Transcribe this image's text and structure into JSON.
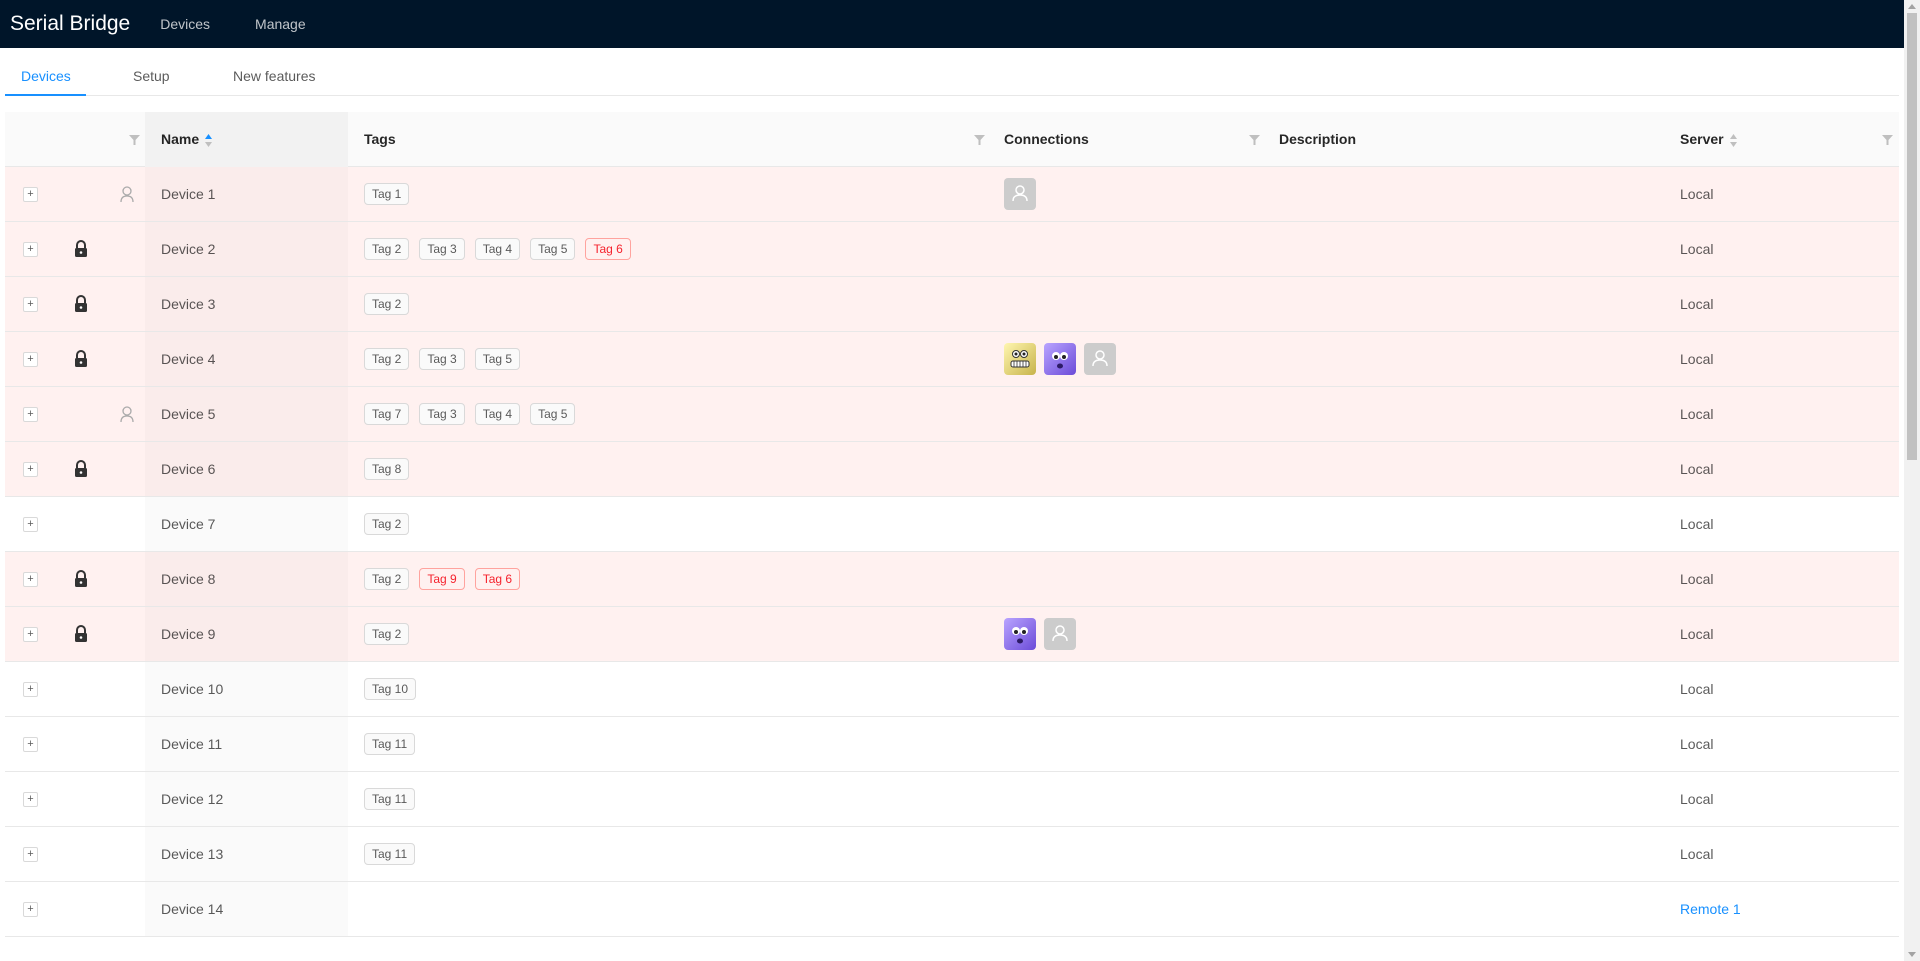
{
  "header": {
    "brand": "Serial Bridge",
    "nav": [
      {
        "label": "Devices"
      },
      {
        "label": "Manage"
      }
    ]
  },
  "tabs": [
    {
      "label": "Devices",
      "active": true
    },
    {
      "label": "Setup"
    },
    {
      "label": "New features"
    }
  ],
  "table": {
    "columns": {
      "name": "Name",
      "tags": "Tags",
      "connections": "Connections",
      "description": "Description",
      "server": "Server"
    },
    "rows": [
      {
        "name": "Device 1",
        "status": "user-icon",
        "alert": true,
        "tags": [
          {
            "label": "Tag 1"
          }
        ],
        "connections": [
          "placeholder"
        ],
        "server": "Local"
      },
      {
        "name": "Device 2",
        "status": "lock-icon",
        "alert": true,
        "tags": [
          {
            "label": "Tag 2"
          },
          {
            "label": "Tag 3"
          },
          {
            "label": "Tag 4"
          },
          {
            "label": "Tag 5"
          },
          {
            "label": "Tag 6",
            "red": true
          }
        ],
        "connections": [],
        "server": "Local"
      },
      {
        "name": "Device 3",
        "status": "lock-icon",
        "alert": true,
        "tags": [
          {
            "label": "Tag 2"
          }
        ],
        "connections": [],
        "server": "Local"
      },
      {
        "name": "Device 4",
        "status": "lock-icon",
        "alert": true,
        "tags": [
          {
            "label": "Tag 2"
          },
          {
            "label": "Tag 3"
          },
          {
            "label": "Tag 5"
          }
        ],
        "connections": [
          "yellow",
          "purple",
          "placeholder"
        ],
        "server": "Local"
      },
      {
        "name": "Device 5",
        "status": "user-icon",
        "alert": true,
        "tags": [
          {
            "label": "Tag 7"
          },
          {
            "label": "Tag 3"
          },
          {
            "label": "Tag 4"
          },
          {
            "label": "Tag 5"
          }
        ],
        "connections": [],
        "server": "Local"
      },
      {
        "name": "Device 6",
        "status": "lock-icon",
        "alert": true,
        "tags": [
          {
            "label": "Tag 8"
          }
        ],
        "connections": [],
        "server": "Local"
      },
      {
        "name": "Device 7",
        "status": "",
        "alert": false,
        "tags": [
          {
            "label": "Tag 2"
          }
        ],
        "connections": [],
        "server": "Local"
      },
      {
        "name": "Device 8",
        "status": "lock-icon",
        "alert": true,
        "tags": [
          {
            "label": "Tag 2"
          },
          {
            "label": "Tag 9",
            "red": true
          },
          {
            "label": "Tag 6",
            "red": true
          }
        ],
        "connections": [],
        "server": "Local"
      },
      {
        "name": "Device 9",
        "status": "lock-icon",
        "alert": true,
        "tags": [
          {
            "label": "Tag 2"
          }
        ],
        "connections": [
          "purple",
          "placeholder"
        ],
        "server": "Local"
      },
      {
        "name": "Device 10",
        "status": "",
        "alert": false,
        "tags": [
          {
            "label": "Tag 10"
          }
        ],
        "connections": [],
        "server": "Local"
      },
      {
        "name": "Device 11",
        "status": "",
        "alert": false,
        "tags": [
          {
            "label": "Tag 11"
          }
        ],
        "connections": [],
        "server": "Local"
      },
      {
        "name": "Device 12",
        "status": "",
        "alert": false,
        "tags": [
          {
            "label": "Tag 11"
          }
        ],
        "connections": [],
        "server": "Local"
      },
      {
        "name": "Device 13",
        "status": "",
        "alert": false,
        "tags": [
          {
            "label": "Tag 11"
          }
        ],
        "connections": [],
        "server": "Local"
      },
      {
        "name": "Device 14",
        "status": "",
        "alert": false,
        "tags": [],
        "connections": [],
        "server": "Remote 1",
        "server_link": true
      }
    ]
  },
  "colors": {
    "accent": "#1890ff",
    "header_bg": "#001529",
    "alert_row": "#fff1f0",
    "tag_red": "#f5222d"
  }
}
